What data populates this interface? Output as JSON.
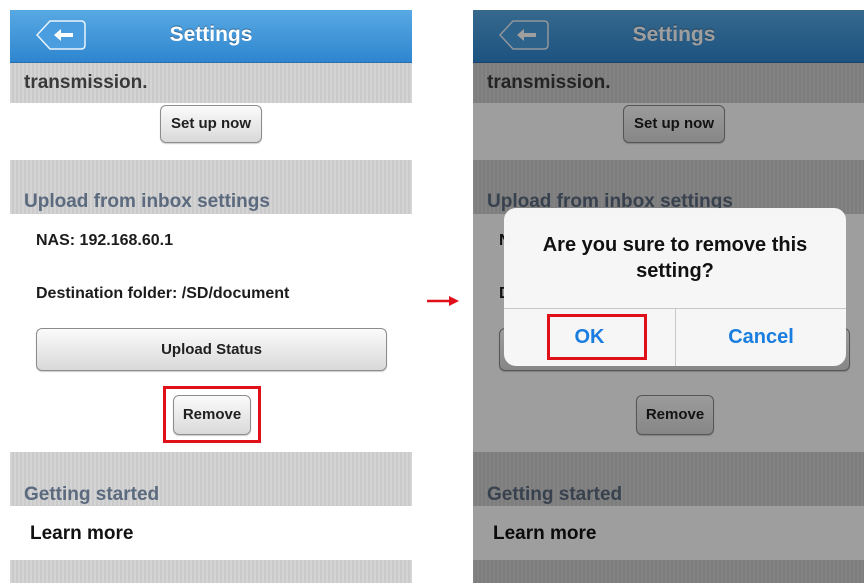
{
  "screens": {
    "before": {
      "nav_title": "Settings",
      "partial_heading": "transmission.",
      "setup_button": "Set up now",
      "upload_section_header": "Upload from inbox settings",
      "nas_line": "NAS: 192.168.60.1",
      "destination_line": "Destination folder: /SD/document",
      "upload_status_button": "Upload Status",
      "remove_button": "Remove",
      "getting_started_header": "Getting started",
      "learn_more": "Learn more"
    },
    "after": {
      "nav_title": "Settings",
      "partial_heading": "transmission.",
      "setup_button": "Set up now",
      "upload_section_header": "Upload from inbox settings",
      "nas_partial": "N",
      "destination_partial": "D",
      "remove_button": "Remove",
      "getting_started_header": "Getting started",
      "learn_more": "Learn more",
      "dialog": {
        "message": "Are you sure to remove this setting?",
        "ok": "OK",
        "cancel": "Cancel"
      }
    }
  },
  "icons": {
    "back": "back-arrow-icon",
    "transition": "right-arrow-icon"
  },
  "colors": {
    "nav": "#3b93d8",
    "highlight": "#e0101b",
    "dialog_button": "#1a7de0",
    "section_text": "#5b6a7e"
  }
}
